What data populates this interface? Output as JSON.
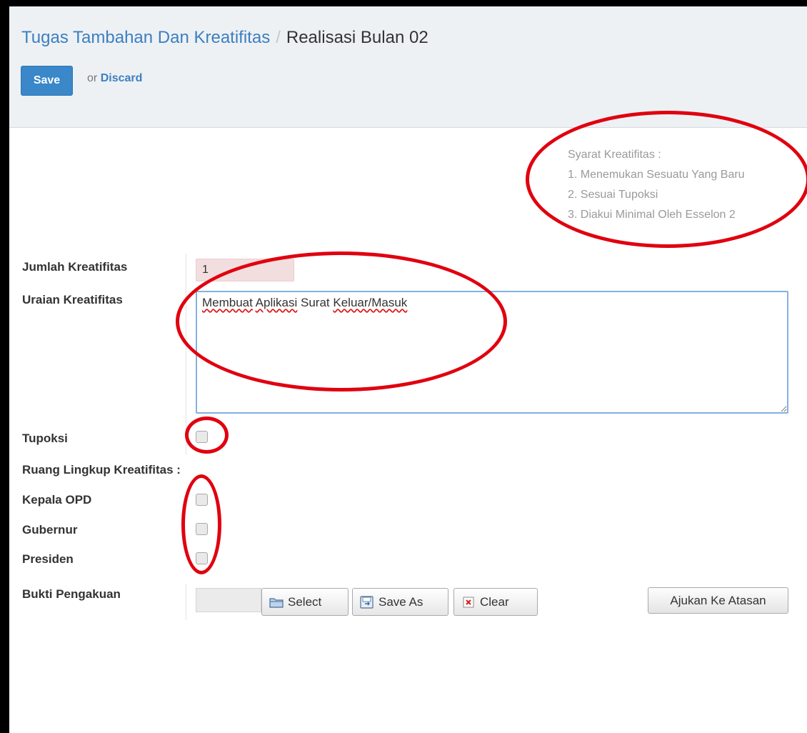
{
  "breadcrumb": {
    "parent": "Tugas Tambahan Dan Kreatifitas",
    "separator": "/",
    "current": "Realisasi Bulan 02"
  },
  "toolbar": {
    "save_label": "Save",
    "or_text": "or",
    "discard_label": "Discard"
  },
  "requirements": {
    "title": "Syarat Kreatifitas :",
    "items": [
      "1. Menemukan Sesuatu Yang Baru",
      "2. Sesuai Tupoksi",
      "3. Diakui Minimal Oleh Esselon 2"
    ]
  },
  "form": {
    "jumlah": {
      "label": "Jumlah Kreatifitas",
      "value": "1"
    },
    "uraian": {
      "label": "Uraian Kreatifitas",
      "words": [
        "Membuat",
        "Aplikasi",
        "Surat",
        "Keluar/Masuk"
      ]
    },
    "tupoksi": {
      "label": "Tupoksi",
      "checked": false
    },
    "ruang_lingkup": {
      "label": "Ruang Lingkup Kreatifitas :",
      "options": [
        {
          "label": "Kepala OPD",
          "checked": false
        },
        {
          "label": "Gubernur",
          "checked": false
        },
        {
          "label": "Presiden",
          "checked": false
        }
      ]
    },
    "bukti": {
      "label": "Bukti Pengakuan",
      "select_label": "Select",
      "save_as_label": "Save As",
      "clear_label": "Clear"
    }
  },
  "submit_label": "Ajukan Ke Atasan",
  "colors": {
    "link": "#3c7fc1",
    "save_button": "#3a87c9",
    "header_bg": "#eef1f4",
    "annotation": "#e0000f",
    "invalid_bg": "#f2dede"
  },
  "icons": [
    "folder-icon",
    "save-as-icon",
    "clear-x-icon"
  ]
}
